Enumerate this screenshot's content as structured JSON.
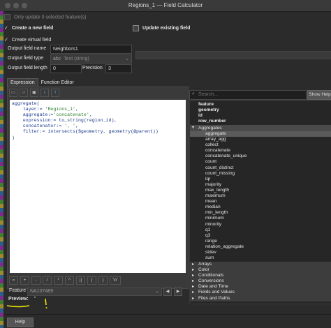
{
  "window": {
    "title": "Regions_1 — Field Calculator"
  },
  "top": {
    "only_update_label": "Only update 0 selected feature(s)"
  },
  "create_new_field": {
    "label": "Create a new field",
    "virtual_label": "Create virtual field",
    "output_name_label": "Output field name",
    "output_name_value": "Neighbors1",
    "output_type_label": "Output field type",
    "output_type_value": "Text (string)",
    "length_label": "Output field length",
    "length_value": "0",
    "precision_label": "Precision",
    "precision_value": "3"
  },
  "update_existing": {
    "label": "Update existing field"
  },
  "tabs": [
    "Expression",
    "Function Editor"
  ],
  "expression_lines": [
    "aggregate(",
    "    layer:= 'Regions_1',",
    "    aggregate:='concatenate',",
    "    expression:= to_string(region_id),",
    "    concatenator:= ', ',",
    "    filter:= intersects($geometry, geometry(@parent))",
    ")"
  ],
  "operators": [
    "=",
    "+",
    "-",
    "/",
    "*",
    "^",
    "||",
    "(",
    ")",
    "'\\n'"
  ],
  "feature": {
    "label": "Feature",
    "value": "NA107489"
  },
  "preview": {
    "label": "Preview:",
    "value": "''"
  },
  "search": {
    "placeholder": "Search...",
    "show_help": "Show Help"
  },
  "tree_top": [
    "feature",
    "geometry",
    "id",
    "row_number"
  ],
  "aggregates_group": "Aggregates",
  "aggregates": [
    "aggregate",
    "array_agg",
    "collect",
    "concatenate",
    "concatenate_unique",
    "count",
    "count_distinct",
    "count_missing",
    "iqr",
    "majority",
    "max_length",
    "maximum",
    "mean",
    "median",
    "min_length",
    "minimum",
    "minority",
    "q1",
    "q3",
    "range",
    "relation_aggregate",
    "stdev",
    "sum"
  ],
  "groups_bottom": [
    "Arrays",
    "Color",
    "Conditionals",
    "Conversions",
    "Date and Time",
    "Fields and Values",
    "Files and Paths"
  ],
  "help_button": "Help"
}
